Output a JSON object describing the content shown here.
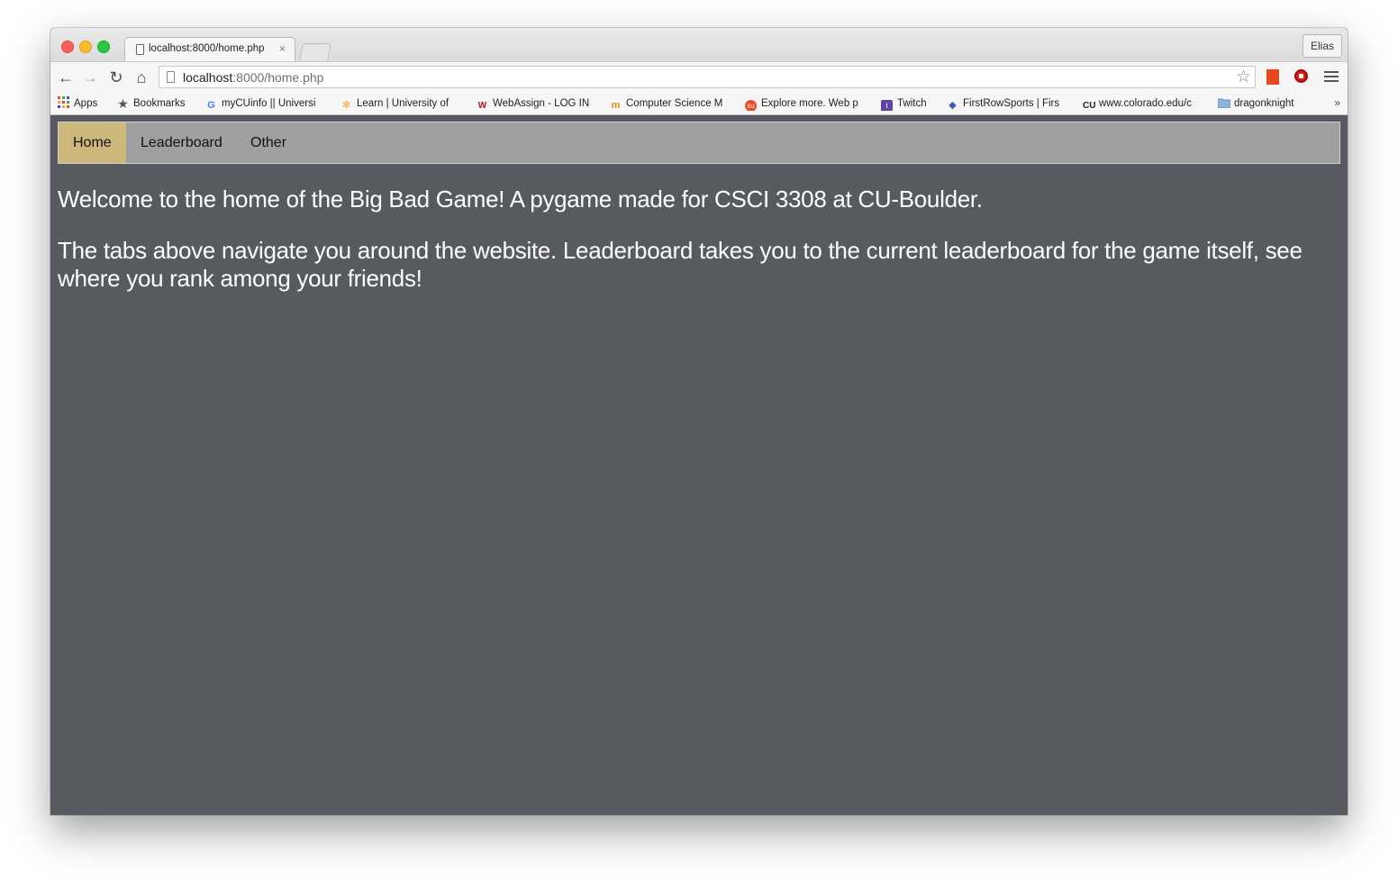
{
  "browser": {
    "tab": {
      "title": "localhost:8000/home.php",
      "close": "×"
    },
    "profile_name": "Elias",
    "toolbar": {
      "back_icon": "←",
      "forward_icon": "→",
      "reload_icon": "↻",
      "home_icon": "⌂",
      "url_host": "localhost",
      "url_path": ":8000/home.php",
      "star_icon": "☆"
    },
    "bookmarks": [
      {
        "icon": "apps-grid-icon",
        "label": "Apps"
      },
      {
        "icon": "star-icon",
        "label": "Bookmarks"
      },
      {
        "icon": "google-icon",
        "label": "myCUinfo || Universi"
      },
      {
        "icon": "learn-icon",
        "label": "Learn | University of"
      },
      {
        "icon": "webassign-icon",
        "label": "WebAssign - LOG IN"
      },
      {
        "icon": "moodle-icon",
        "label": "Computer Science M"
      },
      {
        "icon": "stumbleupon-icon",
        "label": "Explore more. Web p"
      },
      {
        "icon": "twitch-icon",
        "label": "Twitch"
      },
      {
        "icon": "firstrow-icon",
        "label": "FirstRowSports | Firs"
      },
      {
        "icon": "cu-icon",
        "label": "www.colorado.edu/c"
      },
      {
        "icon": "folder-icon",
        "label": "dragonknight"
      }
    ],
    "overflow": "»"
  },
  "site": {
    "nav": [
      {
        "label": "Home",
        "active": true
      },
      {
        "label": "Leaderboard",
        "active": false
      },
      {
        "label": "Other",
        "active": false
      }
    ],
    "paragraphs": [
      "Welcome to the home of the Big Bad Game! A pygame made for CSCI 3308 at CU-Boulder.",
      "The tabs above navigate you around the website. Leaderboard takes you to the current leaderboard for the game itself, see where you rank among your friends!"
    ]
  },
  "colors": {
    "page_background": "#575a5e",
    "navbar_background": "#a0a0a0",
    "nav_active": "#ccb87b"
  }
}
